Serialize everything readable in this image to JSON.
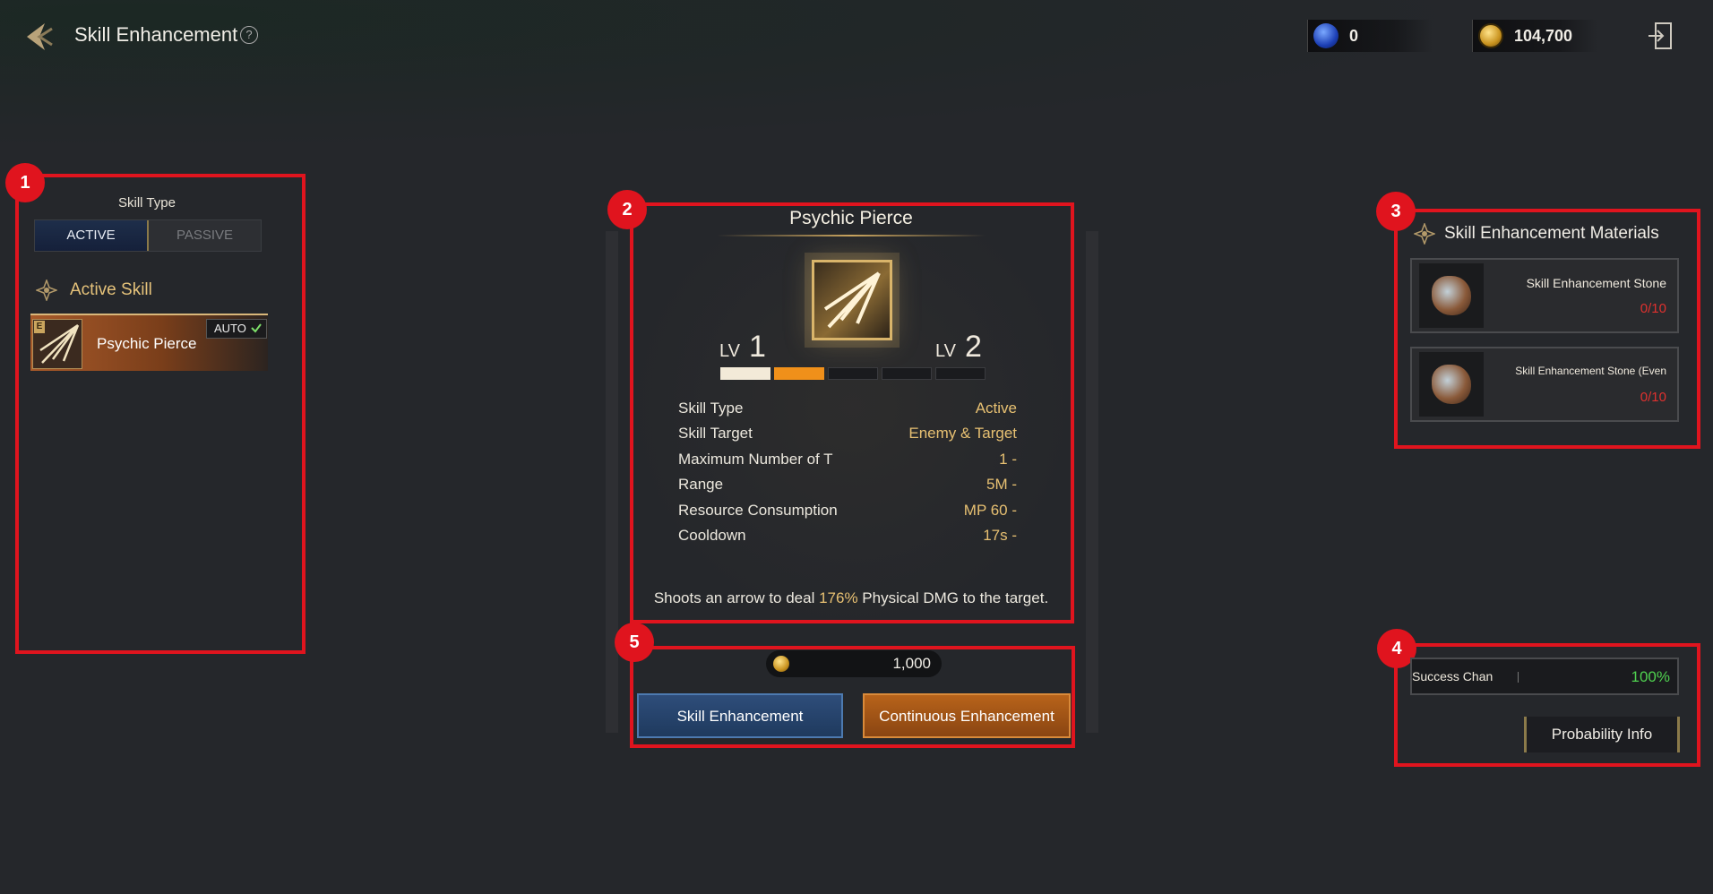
{
  "header": {
    "title": "Skill Enhancement",
    "help": "?",
    "gem_amount": "0",
    "gold_amount": "104,700"
  },
  "markers": [
    "1",
    "2",
    "3",
    "4",
    "5"
  ],
  "left_panel": {
    "skill_type_label": "Skill Type",
    "active_tab": "ACTIVE",
    "passive_tab": "PASSIVE",
    "section_title": "Active Skill",
    "skill": {
      "grade": "E",
      "name": "Psychic Pierce",
      "auto_label": "AUTO"
    }
  },
  "detail": {
    "name": "Psychic Pierce",
    "lv_prefix": "LV",
    "current_level": "1",
    "next_level": "2",
    "progress_filled_segments": 2,
    "progress_total_segments": 5,
    "stats": [
      {
        "label": "Skill Type",
        "value": "Active"
      },
      {
        "label": "Skill Target",
        "value": "Enemy & Target"
      },
      {
        "label": "Maximum Number of T",
        "value": "1 -"
      },
      {
        "label": "Range",
        "value": "5M -"
      },
      {
        "label": "Resource Consumption",
        "value": "MP 60 -"
      },
      {
        "label": "Cooldown",
        "value": "17s -"
      }
    ],
    "desc_pre": "Shoots an arrow to deal ",
    "desc_hl": "176%",
    "desc_post": " Physical DMG to the target."
  },
  "actions": {
    "cost": "1,000",
    "skill_enhancement": "Skill Enhancement",
    "continuous_enhancement": "Continuous Enhancement"
  },
  "materials": {
    "title": "Skill Enhancement Materials",
    "items": [
      {
        "name": "Skill Enhancement Stone",
        "count": "0/10"
      },
      {
        "name": "Skill Enhancement Stone (Even",
        "count": "0/10"
      }
    ]
  },
  "probability": {
    "success_label": "Success Chan",
    "success_value": "100%",
    "info_button": "Probability Info"
  },
  "colors": {
    "highlight": "#e0141e",
    "gold_text": "#e7c072",
    "success": "#4fd14f",
    "count_red": "#e0312e"
  }
}
